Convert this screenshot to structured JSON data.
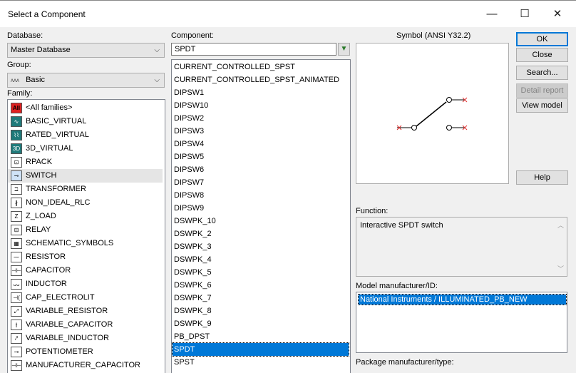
{
  "window": {
    "title": "Select a Component",
    "minimize_glyph": "—",
    "maximize_glyph": "☐",
    "close_glyph": "✕"
  },
  "database": {
    "label": "Database:",
    "value": "Master Database"
  },
  "group": {
    "label": "Group:",
    "value": "Basic",
    "icon": "basic-group-icon",
    "icon_glyph": "ᴧᴧᴧ"
  },
  "family": {
    "label": "Family:",
    "items": [
      {
        "label": "<All families>",
        "icon": "all-families-icon",
        "glyph": "All"
      },
      {
        "label": "BASIC_VIRTUAL",
        "icon": "basic-virtual-icon",
        "glyph": "∿"
      },
      {
        "label": "RATED_VIRTUAL",
        "icon": "rated-virtual-icon",
        "glyph": "⌇⌇"
      },
      {
        "label": "3D_VIRTUAL",
        "icon": "3d-virtual-icon",
        "glyph": "3D"
      },
      {
        "label": "RPACK",
        "icon": "rpack-icon",
        "glyph": "⊡"
      },
      {
        "label": "SWITCH",
        "icon": "switch-icon",
        "glyph": "⊸"
      },
      {
        "label": "TRANSFORMER",
        "icon": "transformer-icon",
        "glyph": "ℶ"
      },
      {
        "label": "NON_IDEAL_RLC",
        "icon": "non-ideal-rlc-icon",
        "glyph": "∦"
      },
      {
        "label": "Z_LOAD",
        "icon": "z-load-icon",
        "glyph": "Z"
      },
      {
        "label": "RELAY",
        "icon": "relay-icon",
        "glyph": "⊟"
      },
      {
        "label": "SCHEMATIC_SYMBOLS",
        "icon": "schematic-symbols-icon",
        "glyph": "▦"
      },
      {
        "label": "RESISTOR",
        "icon": "resistor-icon",
        "glyph": "⁓"
      },
      {
        "label": "CAPACITOR",
        "icon": "capacitor-icon",
        "glyph": "⊣⊢"
      },
      {
        "label": "INDUCTOR",
        "icon": "inductor-icon",
        "glyph": "ᴗᴗ"
      },
      {
        "label": "CAP_ELECTROLIT",
        "icon": "cap-electrolit-icon",
        "glyph": "⊣("
      },
      {
        "label": "VARIABLE_RESISTOR",
        "icon": "variable-resistor-icon",
        "glyph": "⤢"
      },
      {
        "label": "VARIABLE_CAPACITOR",
        "icon": "variable-capacitor-icon",
        "glyph": "⫲"
      },
      {
        "label": "VARIABLE_INDUCTOR",
        "icon": "variable-inductor-icon",
        "glyph": "⤤"
      },
      {
        "label": "POTENTIOMETER",
        "icon": "potentiometer-icon",
        "glyph": "⊸"
      },
      {
        "label": "MANUFACTURER_CAPACITOR",
        "icon": "manufacturer-capacitor-icon",
        "glyph": "⊣⊢"
      }
    ]
  },
  "component": {
    "label": "Component:",
    "search_value": "SPDT",
    "filter_icon": "filter-icon",
    "items": [
      "CURRENT_CONTROLLED_SPST",
      "CURRENT_CONTROLLED_SPST_ANIMATED",
      "DIPSW1",
      "DIPSW10",
      "DIPSW2",
      "DIPSW3",
      "DIPSW4",
      "DIPSW5",
      "DIPSW6",
      "DIPSW7",
      "DIPSW8",
      "DIPSW9",
      "DSWPK_10",
      "DSWPK_2",
      "DSWPK_3",
      "DSWPK_4",
      "DSWPK_5",
      "DSWPK_6",
      "DSWPK_7",
      "DSWPK_8",
      "DSWPK_9",
      "PB_DPST",
      "SPDT",
      "SPST"
    ],
    "selected": "SPDT"
  },
  "symbol": {
    "label": "Symbol (ANSI Y32.2)"
  },
  "buttons": {
    "ok": "OK",
    "close": "Close",
    "search": "Search...",
    "detail_report": "Detail report",
    "view_model": "View model",
    "help": "Help"
  },
  "function": {
    "label": "Function:",
    "value": "Interactive SPDT switch"
  },
  "model": {
    "label": "Model manufacturer/ID:",
    "value": "National Instruments / ILLUMINATED_PB_NEW"
  },
  "package": {
    "label": "Package manufacturer/type:"
  },
  "colors": {
    "selection": "#0078d7",
    "all_families_icon": "#e02020",
    "switch_x": "#e03030"
  }
}
